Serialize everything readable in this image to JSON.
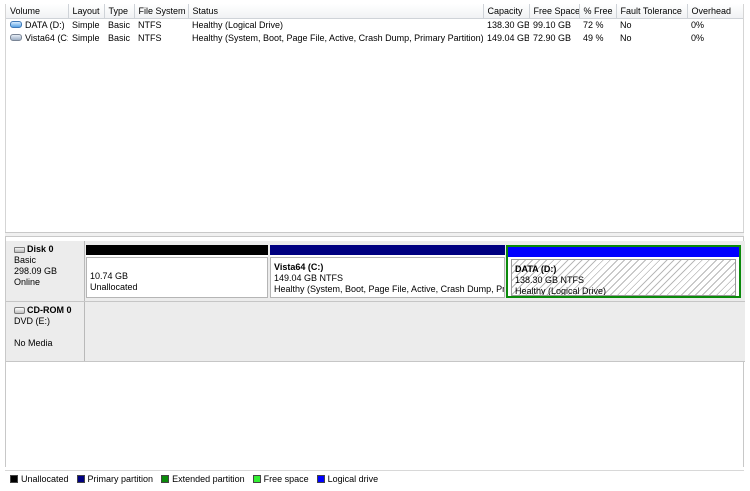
{
  "volume_list": {
    "columns": [
      "Volume",
      "Layout",
      "Type",
      "File System",
      "Status",
      "Capacity",
      "Free Space",
      "% Free",
      "Fault Tolerance",
      "Overhead"
    ],
    "rows": [
      {
        "icon": "volume-drive-icon",
        "cells": [
          "DATA (D:)",
          "Simple",
          "Basic",
          "NTFS",
          "Healthy (Logical Drive)",
          "138.30 GB",
          "99.10 GB",
          "72 %",
          "No",
          "0%"
        ]
      },
      {
        "icon": "volume-drive-icon",
        "cells": [
          "Vista64 (C:)",
          "Simple",
          "Basic",
          "NTFS",
          "Healthy (System, Boot, Page File, Active, Crash Dump, Primary Partition)",
          "149.04 GB",
          "72.90 GB",
          "49 %",
          "No",
          "0%"
        ]
      }
    ]
  },
  "disks": {
    "disk0": {
      "name": "Disk 0",
      "type": "Basic",
      "size": "298.09 GB",
      "state": "Online",
      "partitions": {
        "unallocated": {
          "size": "10.74 GB",
          "status": "Unallocated"
        },
        "primary": {
          "name": "Vista64  (C:)",
          "size_fs": "149.04 GB NTFS",
          "status": "Healthy (System, Boot, Page File, Active, Crash Dump, Pr"
        },
        "logical": {
          "name": "DATA  (D:)",
          "size_fs": "138.30 GB NTFS",
          "status": "Healthy (Logical Drive)"
        }
      }
    },
    "cdrom0": {
      "name": "CD-ROM 0",
      "drive": "DVD (E:)",
      "media": "No Media"
    }
  },
  "legend": [
    {
      "label": "Unallocated",
      "color": "#000000"
    },
    {
      "label": "Primary partition",
      "color": "#000080"
    },
    {
      "label": "Extended partition",
      "color": "#0a8a0a"
    },
    {
      "label": "Free space",
      "color": "#33ee33"
    },
    {
      "label": "Logical drive",
      "color": "#0000ff"
    }
  ]
}
